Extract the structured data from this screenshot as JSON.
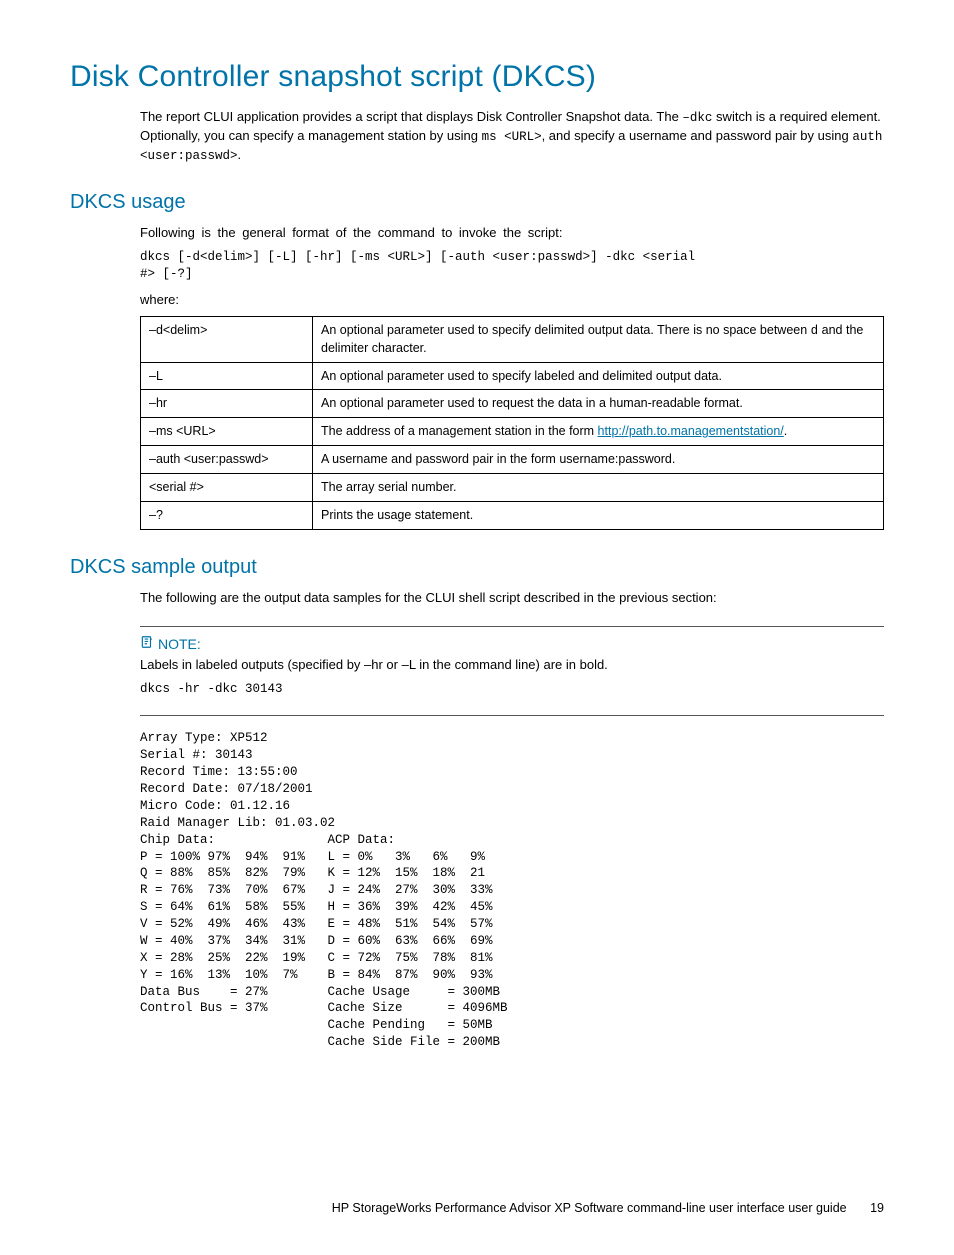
{
  "h1": "Disk Controller snapshot script (DKCS)",
  "intro": {
    "p1a": "The report CLUI application provides a script that displays Disk Controller Snapshot data.  The ",
    "p1b": "–dkc",
    "p1c": " switch is a required element.  Optionally, you can specify a management station by using ",
    "p1d": "ms <URL>",
    "p1e": ", and specify a username and password pair by using ",
    "p1f": "auth <user:passwd>",
    "p1g": "."
  },
  "usage": {
    "heading": "DKCS usage",
    "lead": "Following is the general format of the command to invoke the script:",
    "cmd": "dkcs [-d<delim>] [-L] [-hr] [-ms <URL>] [-auth <user:passwd>] -dkc <serial\n#> [-?]",
    "where": "where:",
    "rows": [
      {
        "k": "–d<delim>",
        "v_a": "An optional parameter used to specify delimited output data.  There is no space between ",
        "v_b": "d",
        "v_c": " and the delimiter character."
      },
      {
        "k": "–L",
        "v_a": "An optional parameter used to specify labeled and delimited output data.",
        "v_b": "",
        "v_c": ""
      },
      {
        "k": "–hr",
        "v_a": "An optional parameter used to request the data in a human-readable format.",
        "v_b": "",
        "v_c": ""
      },
      {
        "k": "–ms <URL>",
        "v_a": "The address of a management station in the form ",
        "v_link": "http://path.to.managementstation/",
        "v_c": "."
      },
      {
        "k": "–auth <user:passwd>",
        "v_a": "A username and password pair in the form username:password.",
        "v_b": "",
        "v_c": ""
      },
      {
        "k": "<serial #>",
        "v_a": "The array serial number.",
        "v_b": "",
        "v_c": ""
      },
      {
        "k": "–?",
        "v_a": "Prints the usage statement.",
        "v_b": "",
        "v_c": ""
      }
    ]
  },
  "sample": {
    "heading": "DKCS sample output",
    "lead": "The following are the output data samples for the CLUI shell script described in the previous section:",
    "note_label": "NOTE:",
    "note_body": "Labels in labeled outputs (specified by –hr or –L in the command line) are in bold.",
    "note_cmd": "dkcs -hr -dkc 30143",
    "output": "Array Type: XP512\nSerial #: 30143\nRecord Time: 13:55:00\nRecord Date: 07/18/2001\nMicro Code: 01.12.16\nRaid Manager Lib: 01.03.02\nChip Data:               ACP Data:\nP = 100% 97%  94%  91%   L = 0%   3%   6%   9%\nQ = 88%  85%  82%  79%   K = 12%  15%  18%  21\nR = 76%  73%  70%  67%   J = 24%  27%  30%  33%\nS = 64%  61%  58%  55%   H = 36%  39%  42%  45%\nV = 52%  49%  46%  43%   E = 48%  51%  54%  57%\nW = 40%  37%  34%  31%   D = 60%  63%  66%  69%\nX = 28%  25%  22%  19%   C = 72%  75%  78%  81%\nY = 16%  13%  10%  7%    B = 84%  87%  90%  93%\nData Bus    = 27%        Cache Usage     = 300MB\nControl Bus = 37%        Cache Size      = 4096MB\n                         Cache Pending   = 50MB\n                         Cache Side File = 200MB"
  },
  "footer": {
    "text": "HP StorageWorks Performance Advisor XP Software command-line user interface user guide",
    "page": "19"
  }
}
